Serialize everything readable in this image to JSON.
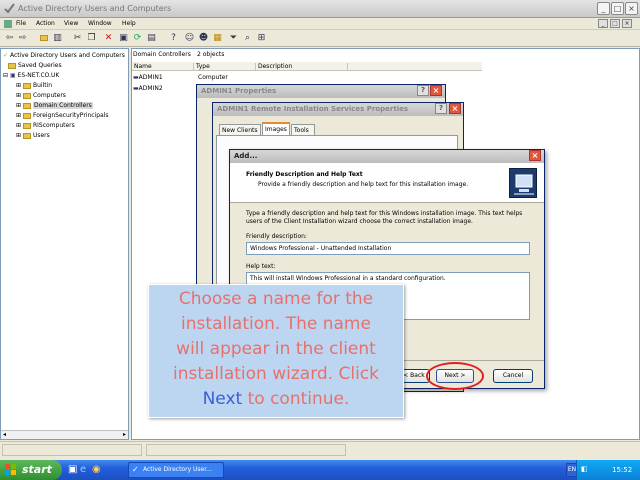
{
  "window": {
    "title": "Active Directory Users and Computers"
  },
  "menu": [
    "File",
    "Action",
    "View",
    "Window",
    "Help"
  ],
  "tree": {
    "root": "Active Directory Users and Computers",
    "items": [
      {
        "label": "Saved Queries",
        "level": 1
      },
      {
        "label": "ES-NET.CO.UK",
        "level": 1
      },
      {
        "label": "Builtin",
        "level": 2
      },
      {
        "label": "Computers",
        "level": 2
      },
      {
        "label": "Domain Controllers",
        "level": 2,
        "selected": true
      },
      {
        "label": "ForeignSecurityPrincipals",
        "level": 2
      },
      {
        "label": "RIScomputers",
        "level": 2
      },
      {
        "label": "Users",
        "level": 2
      }
    ]
  },
  "list": {
    "header_title": "Domain Controllers",
    "header_count": "2 objects",
    "columns": [
      "Name",
      "Type",
      "Description"
    ],
    "rows": [
      {
        "name": "ADMIN1",
        "type": "Computer"
      },
      {
        "name": "ADMIN2",
        "type": ""
      }
    ]
  },
  "props1": {
    "title": "ADMIN1 Properties"
  },
  "props2": {
    "title": "ADMIN1 Remote Installation Services Properties",
    "tabs": [
      "New Clients",
      "Images",
      "Tools"
    ]
  },
  "add_dialog": {
    "title": "Add...",
    "heading": "Friendly Description and Help Text",
    "subheading": "Provide a friendly description and help text for this installation image.",
    "instruction": "Type a friendly description and help text for this Windows installation image. This text helps users of the Client Installation wizard choose the correct installation image.",
    "desc_label": "Friendly description:",
    "desc_value": "Windows Professional - Unattended Installation",
    "help_label": "Help text:",
    "help_value": "This will install Windows Professional in a standard configuration.",
    "back_label": "< Back",
    "next_label": "Next >",
    "cancel_label": "Cancel"
  },
  "tooltip": {
    "line1": "Choose a name for the",
    "line2": "installation. The name",
    "line3": "will appear in the client",
    "line4": "installation wizard. Click",
    "next_word": "Next",
    "line5_rest": " to continue."
  },
  "taskbar": {
    "start_label": "start",
    "task_label": "Active Directory User...",
    "lang": "EN",
    "clock": "15:52"
  },
  "colors": {
    "tooltip_text": "#e8706b",
    "tooltip_highlight": "#3b5ed6",
    "highlight_circle": "#e02020"
  }
}
